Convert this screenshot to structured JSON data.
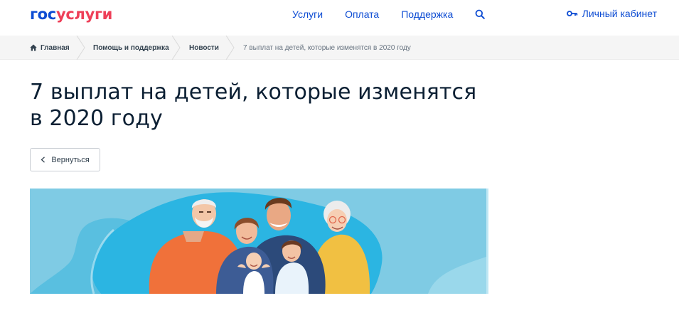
{
  "header": {
    "logo": {
      "part1": "гос",
      "part2": "услуги"
    },
    "nav": [
      {
        "label": "Услуги"
      },
      {
        "label": "Оплата"
      },
      {
        "label": "Поддержка"
      }
    ],
    "search_icon": "search-icon",
    "cabinet": {
      "label": "Личный кабинет",
      "icon": "key-icon"
    }
  },
  "breadcrumb": {
    "items": [
      {
        "label": "Главная",
        "icon": "home-icon"
      },
      {
        "label": "Помощь и поддержка"
      },
      {
        "label": "Новости"
      },
      {
        "label": "7 выплат на детей, которые изменятся в 2020 году"
      }
    ]
  },
  "article": {
    "title_line1": "7 выплат на детей, которые изменятся",
    "title_line2": "в 2020 году",
    "back_label": "Вернуться"
  },
  "colors": {
    "brand_blue": "#0d4cd3",
    "brand_red": "#ee3f58",
    "banner_bg": "#7fcbe4",
    "banner_wave": "#2bb5e2"
  }
}
